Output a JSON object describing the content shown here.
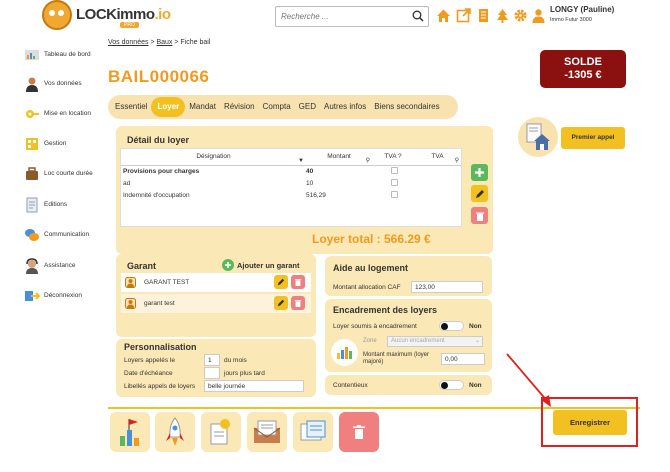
{
  "header": {
    "logo_text_main": "LOCKimmo",
    "logo_text_accent": ".io",
    "logo_sub": "PRO",
    "search_placeholder": "Recherche ...",
    "user_name": "LONGY (Pauline)",
    "user_company": "Immo Futur 3000"
  },
  "sidebar": {
    "items": [
      {
        "label": "Tableau de bord",
        "icon": "dashboard-icon"
      },
      {
        "label": "Vos données",
        "icon": "user-data-icon"
      },
      {
        "label": "Mise en location",
        "icon": "rental-icon"
      },
      {
        "label": "Gestion",
        "icon": "management-icon"
      },
      {
        "label": "Loc courte durée",
        "icon": "short-stay-icon"
      },
      {
        "label": "Editions",
        "icon": "editions-icon"
      },
      {
        "label": "Communication",
        "icon": "communication-icon"
      },
      {
        "label": "Assistance",
        "icon": "support-icon"
      },
      {
        "label": "Déconnexion",
        "icon": "logout-icon"
      }
    ]
  },
  "breadcrumb": {
    "part1": "Vos données",
    "sep": " > ",
    "part2": "Baux",
    "part3": "Fiche bail"
  },
  "page_title": "BAIL000066",
  "solde": {
    "label": "SOLDE",
    "value": "-1305 €"
  },
  "tabs": [
    "Essentiel",
    "Loyer",
    "Mandat",
    "Révision",
    "Compta",
    "GED",
    "Autres infos",
    "Biens secondaires"
  ],
  "active_tab": "Loyer",
  "premier_appel": "Premier appel",
  "detail": {
    "title": "Détail du loyer",
    "columns": [
      "Désignation",
      "Montant",
      "TVA ?",
      "TVA"
    ],
    "rows": [
      {
        "designation": "Provisions pour charges",
        "montant": "40"
      },
      {
        "designation": "ad",
        "montant": "10"
      },
      {
        "designation": "Indemnité d'occupation",
        "montant": "516,29"
      }
    ],
    "total": "Loyer total : 566.29 €"
  },
  "garant": {
    "title": "Garant",
    "add_label": "Ajouter un garant",
    "items": [
      "GARANT TEST",
      "garant test"
    ]
  },
  "perso": {
    "title": "Personnalisation",
    "appel_label": "Loyers appelés le",
    "appel_value": "1",
    "appel_suffix": "du mois",
    "echeance_label": "Date d'échéance",
    "echeance_value": "",
    "echeance_suffix": "jours plus tard",
    "libelles_label": "Libellés appels de loyers",
    "libelles_value": "belle journée"
  },
  "aide": {
    "title": "Aide au logement",
    "caf_label": "Montant allocation CAF",
    "caf_value": "123,00"
  },
  "encadrement": {
    "title": "Encadrement des loyers",
    "soumis_label": "Loyer soumis à encadrement",
    "soumis_value": "Non",
    "zone_label": "Zone",
    "zone_value": "Aucun encadrement",
    "max_label": "Montant maximum (loyer majoré)",
    "max_value": "0,00"
  },
  "contentieux": {
    "label": "Contentieux",
    "value": "Non"
  },
  "save_label": "Enregistrer",
  "colors": {
    "accent": "#f3c021",
    "orange": "#f29a1f",
    "panel": "#fbe8b7",
    "solde_bg": "#8b1010",
    "red_highlight": "#e02020",
    "green": "#5cb85c",
    "red_btn": "#f08080"
  }
}
